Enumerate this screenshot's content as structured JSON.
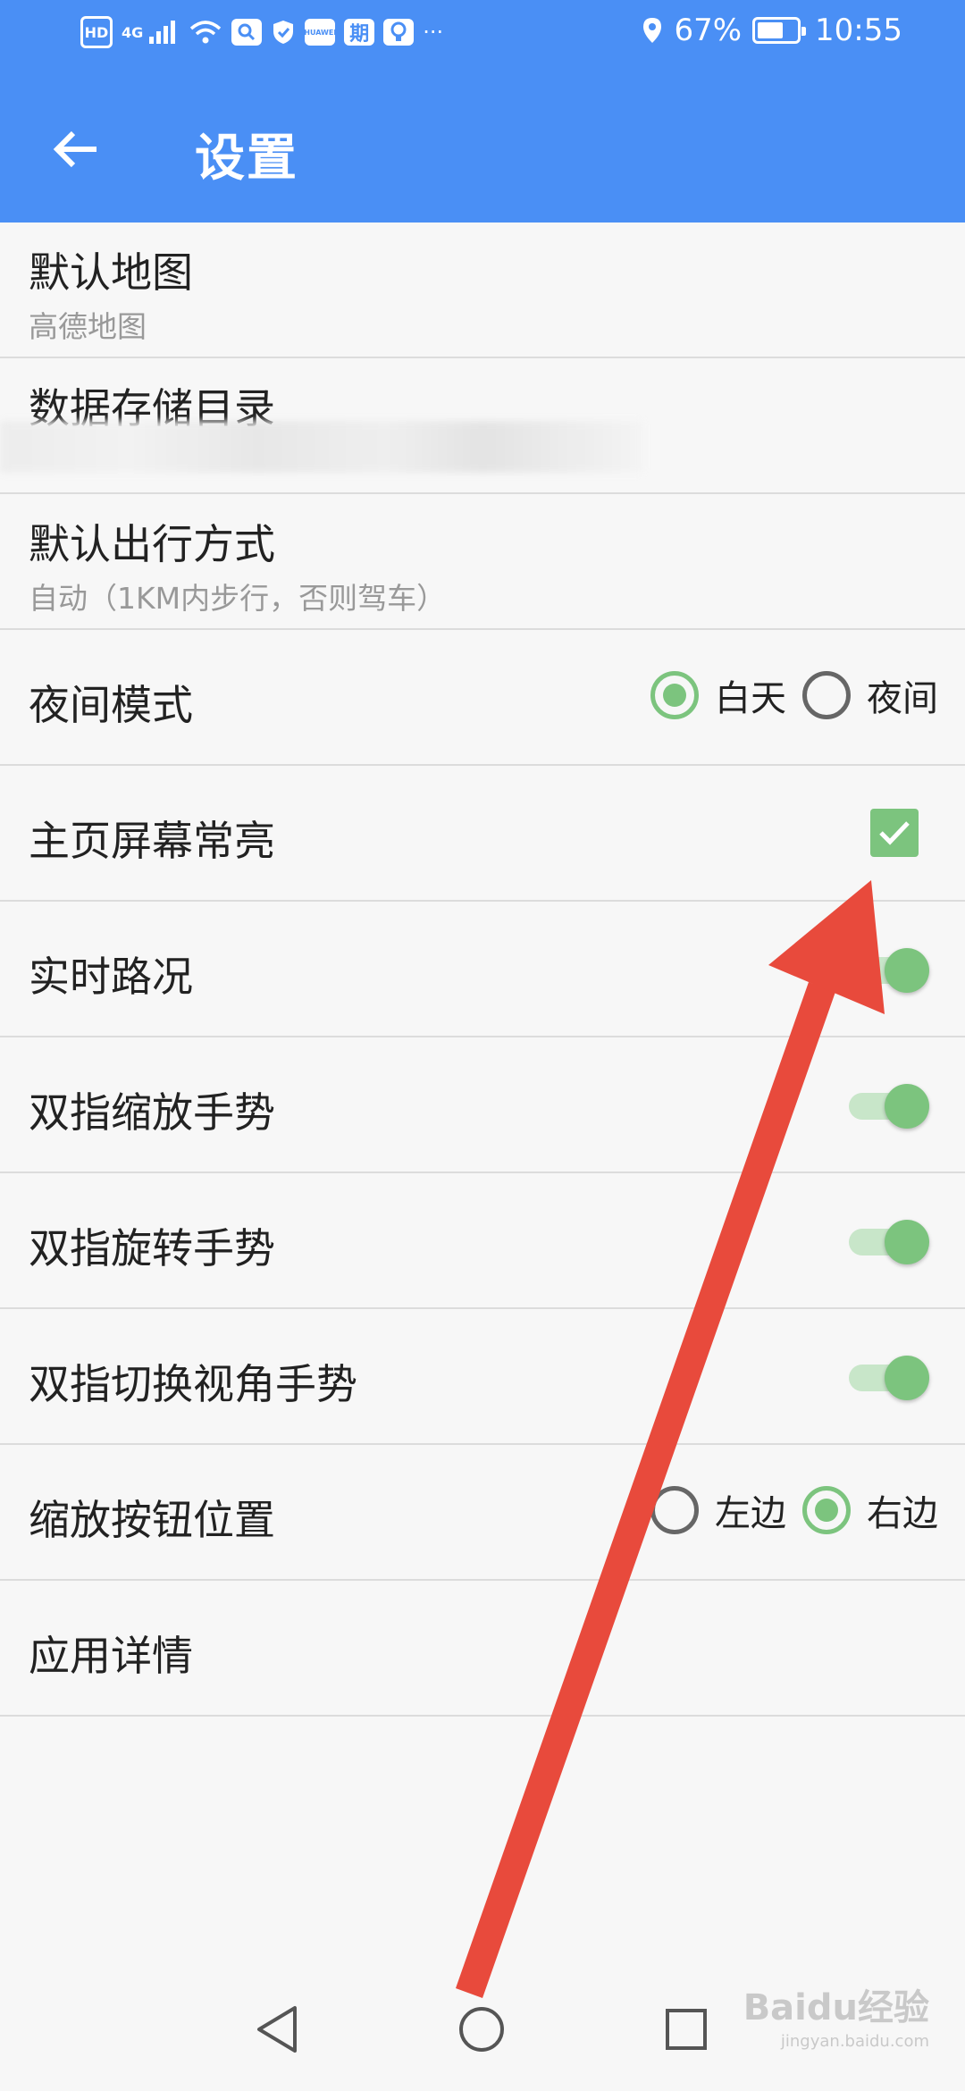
{
  "status_bar": {
    "hd_label": "HD",
    "network_label": "4G",
    "badge_huawei": "HUAWEI",
    "badge_qi": "期",
    "more_label": "···",
    "battery_percent": "67%",
    "battery_level": 0.67,
    "time": "10:55"
  },
  "header": {
    "title": "设置"
  },
  "settings": {
    "default_map": {
      "title": "默认地图",
      "value": "高德地图"
    },
    "data_dir": {
      "title": "数据存储目录",
      "value": ""
    },
    "default_travel": {
      "title": "默认出行方式",
      "value": "自动（1KM内步行，否则驾车）"
    },
    "night_mode": {
      "title": "夜间模式",
      "options": [
        {
          "label": "白天",
          "selected": true
        },
        {
          "label": "夜间",
          "selected": false
        }
      ]
    },
    "keep_screen_on": {
      "title": "主页屏幕常亮",
      "checked": true
    },
    "realtime_traffic": {
      "title": "实时路况",
      "on": true
    },
    "pinch_zoom": {
      "title": "双指缩放手势",
      "on": true
    },
    "rotate_gesture": {
      "title": "双指旋转手势",
      "on": true
    },
    "tilt_gesture": {
      "title": "双指切换视角手势",
      "on": true
    },
    "zoom_button_position": {
      "title": "缩放按钮位置",
      "options": [
        {
          "label": "左边",
          "selected": false
        },
        {
          "label": "右边",
          "selected": true
        }
      ]
    },
    "app_details": {
      "title": "应用详情"
    }
  },
  "watermark": {
    "brand": "Baidu经验",
    "url": "jingyan.baidu.com"
  },
  "colors": {
    "primary": "#4a8ff5",
    "accent_green": "#7cc47e",
    "annotation_arrow": "#e84a3c"
  },
  "icons": {
    "back": "arrow-left-icon",
    "check": "check-icon",
    "nav_back": "triangle-back-icon",
    "nav_home": "circle-home-icon",
    "nav_recent": "square-recent-icon"
  }
}
